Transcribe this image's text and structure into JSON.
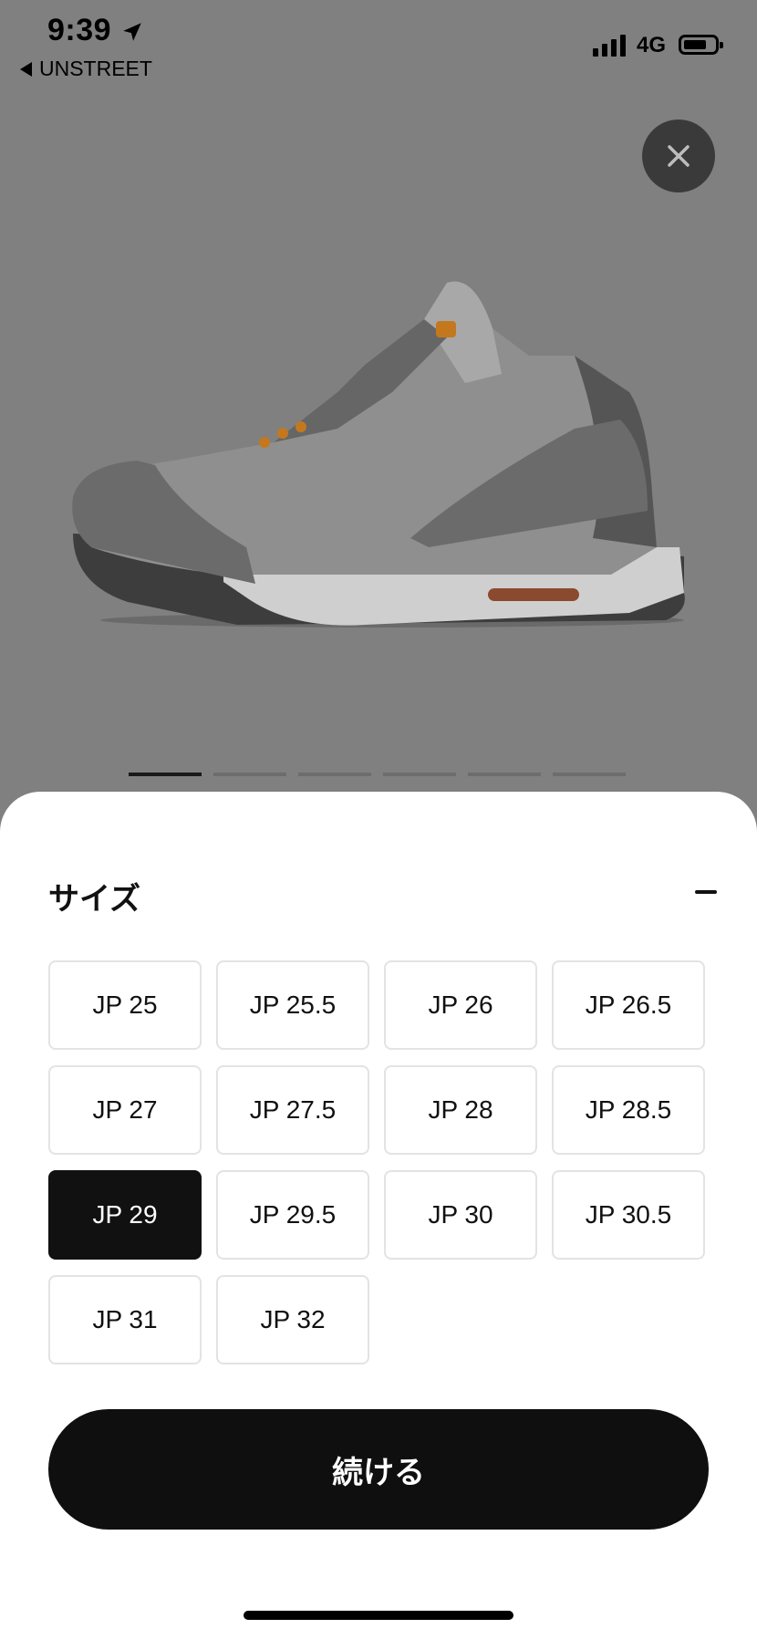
{
  "status_bar": {
    "time": "9:39",
    "network": "4G",
    "back_app": "UNSTREET"
  },
  "product_image": {
    "alt": "gray sneaker",
    "page_count": 6,
    "active_page": 1
  },
  "size_sheet": {
    "title": "サイズ",
    "sizes": [
      "JP 25",
      "JP 25.5",
      "JP 26",
      "JP 26.5",
      "JP 27",
      "JP 27.5",
      "JP 28",
      "JP 28.5",
      "JP 29",
      "JP 29.5",
      "JP 30",
      "JP 30.5",
      "JP 31",
      "JP 32"
    ],
    "selected": "JP 29",
    "continue_label": "続ける"
  },
  "colors": {
    "selected": "#111111",
    "overlay": "#808080"
  }
}
